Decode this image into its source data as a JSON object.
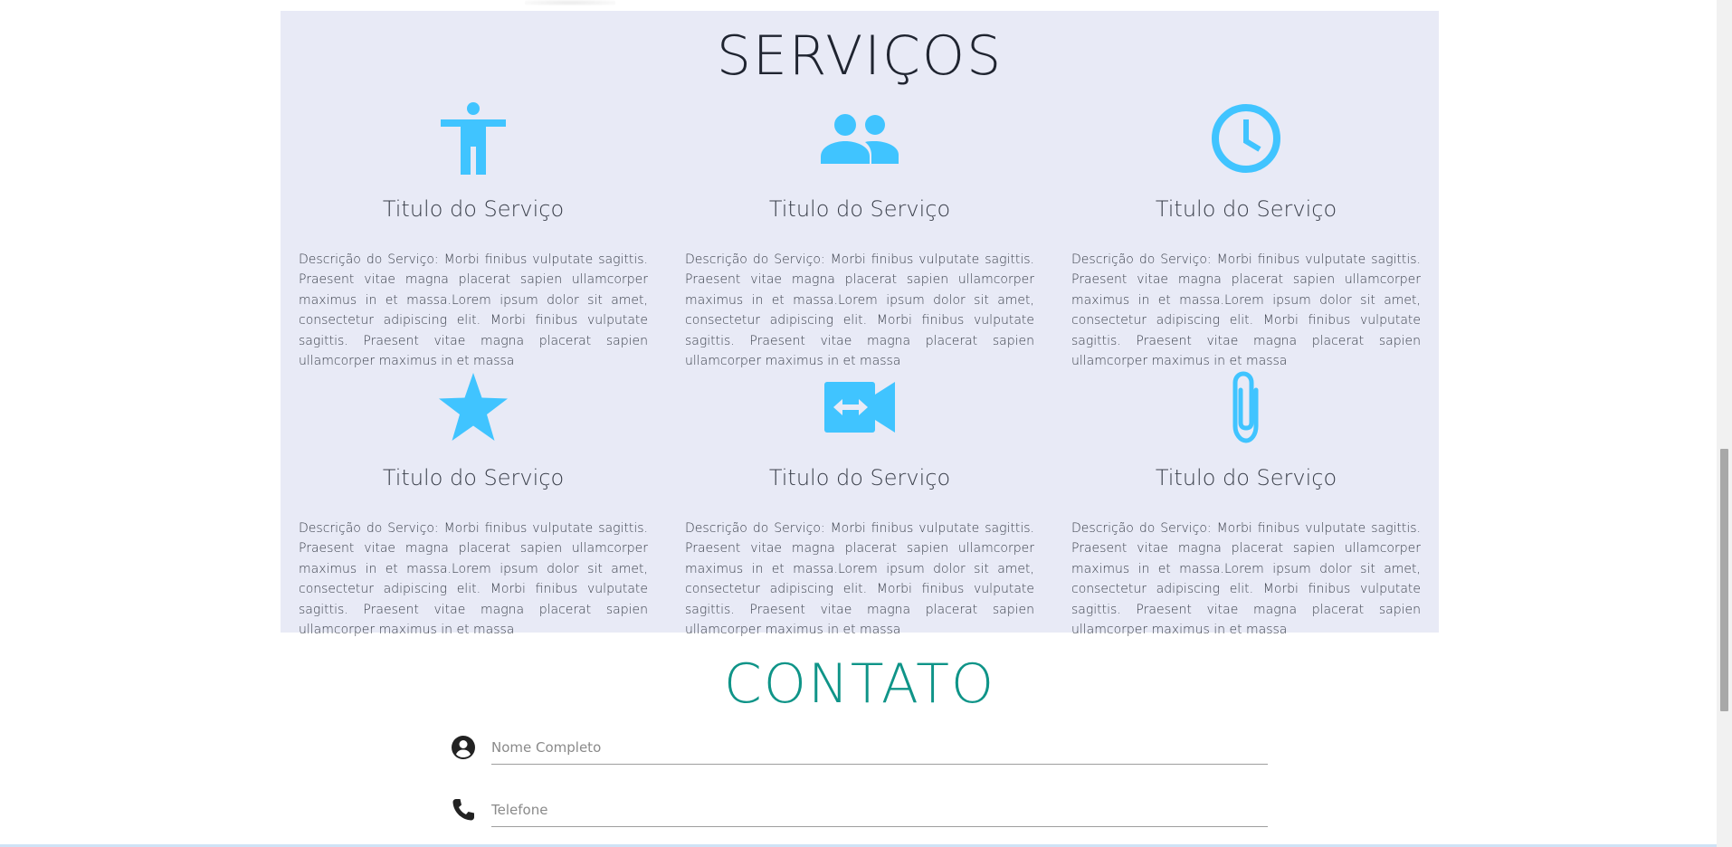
{
  "services": {
    "title": "SERVIÇOS",
    "icon_color": "#40c4ff",
    "cards": [
      {
        "icon": "accessibility-icon",
        "title": "Titulo do Serviço",
        "description": "Descrição do Serviço: Morbi finibus vulputate sagittis. Praesent vitae magna placerat sapien ullamcorper maximus in et massa.Lorem ipsum dolor sit amet, consectetur adipiscing elit. Morbi finibus vulputate sagittis. Praesent vitae magna placerat sapien ullamcorper maximus in et massa"
      },
      {
        "icon": "people-icon",
        "title": "Titulo do Serviço",
        "description": "Descrição do Serviço: Morbi finibus vulputate sagittis. Praesent vitae magna placerat sapien ullamcorper maximus in et massa.Lorem ipsum dolor sit amet, consectetur adipiscing elit. Morbi finibus vulputate sagittis. Praesent vitae magna placerat sapien ullamcorper maximus in et massa"
      },
      {
        "icon": "clock-icon",
        "title": "Titulo do Serviço",
        "description": "Descrição do Serviço: Morbi finibus vulputate sagittis. Praesent vitae magna placerat sapien ullamcorper maximus in et massa.Lorem ipsum dolor sit amet, consectetur adipiscing elit. Morbi finibus vulputate sagittis. Praesent vitae magna placerat sapien ullamcorper maximus in et massa"
      },
      {
        "icon": "star-icon",
        "title": "Titulo do Serviço",
        "description": "Descrição do Serviço: Morbi finibus vulputate sagittis. Praesent vitae magna placerat sapien ullamcorper maximus in et massa.Lorem ipsum dolor sit amet, consectetur adipiscing elit. Morbi finibus vulputate sagittis. Praesent vitae magna placerat sapien ullamcorper maximus in et massa"
      },
      {
        "icon": "video-camera-icon",
        "title": "Titulo do Serviço",
        "description": "Descrição do Serviço: Morbi finibus vulputate sagittis. Praesent vitae magna placerat sapien ullamcorper maximus in et massa.Lorem ipsum dolor sit amet, consectetur adipiscing elit. Morbi finibus vulputate sagittis. Praesent vitae magna placerat sapien ullamcorper maximus in et massa"
      },
      {
        "icon": "paperclip-icon",
        "title": "Titulo do Serviço",
        "description": "Descrição do Serviço: Morbi finibus vulputate sagittis. Praesent vitae magna placerat sapien ullamcorper maximus in et massa.Lorem ipsum dolor sit amet, consectetur adipiscing elit. Morbi finibus vulputate sagittis. Praesent vitae magna placerat sapien ullamcorper maximus in et massa"
      }
    ]
  },
  "contact": {
    "title": "CONTATO",
    "title_color": "#0f9488",
    "fields": [
      {
        "icon": "account-circle-icon",
        "placeholder": "Nome Completo"
      },
      {
        "icon": "phone-icon",
        "placeholder": "Telefone"
      }
    ]
  },
  "colors": {
    "services_background": "#e8eaf6",
    "text": "#3a3f4a"
  }
}
